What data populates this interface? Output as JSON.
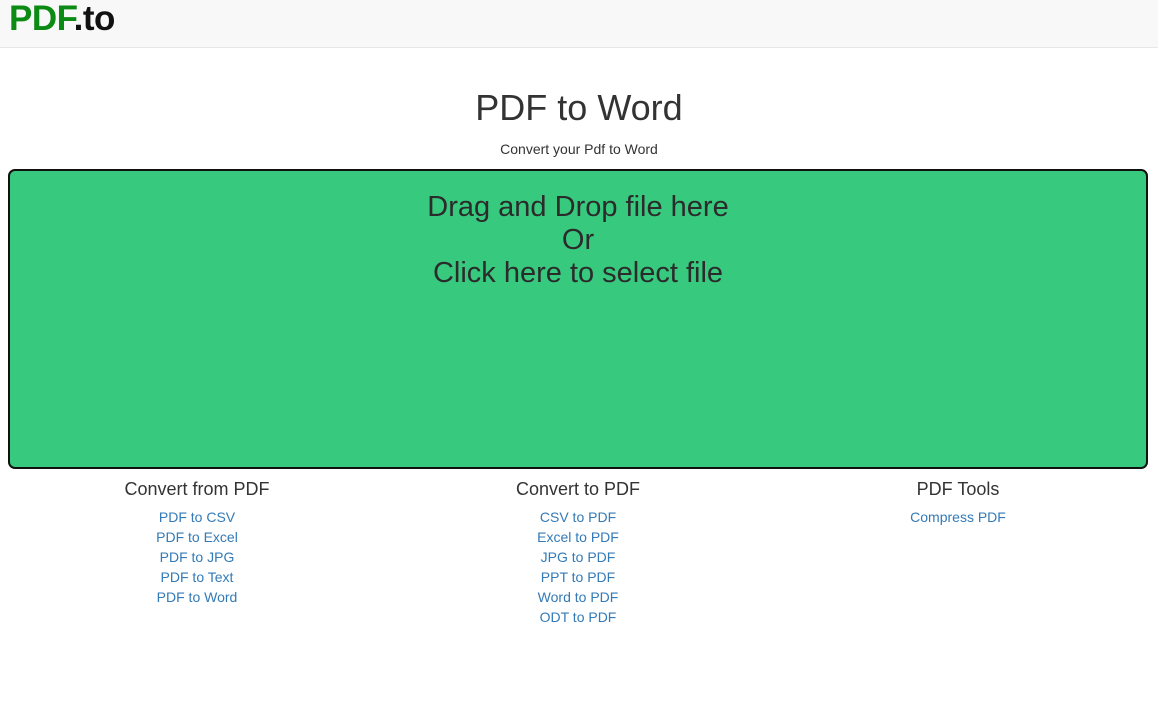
{
  "navbar": {
    "brand_part1": "PDF",
    "brand_part2": ".to",
    "brand_color_pdf": "#0b8a14",
    "brand_color_to": "#111111"
  },
  "hero": {
    "title": "PDF to Word",
    "subtitle": "Convert your Pdf to Word"
  },
  "dropzone": {
    "line1": "Drag and Drop file here",
    "line2": "Or",
    "line3": "Click here to select file",
    "background_color": "#37c97d"
  },
  "columns": [
    {
      "title": "Convert from PDF",
      "links": [
        "PDF to CSV",
        "PDF to Excel",
        "PDF to JPG",
        "PDF to Text",
        "PDF to Word"
      ]
    },
    {
      "title": "Convert to PDF",
      "links": [
        "CSV to PDF",
        "Excel to PDF",
        "JPG to PDF",
        "PPT to PDF",
        "Word to PDF",
        "ODT to PDF"
      ]
    },
    {
      "title": "PDF Tools",
      "links": [
        "Compress PDF"
      ]
    }
  ],
  "link_color": "#337ab7"
}
